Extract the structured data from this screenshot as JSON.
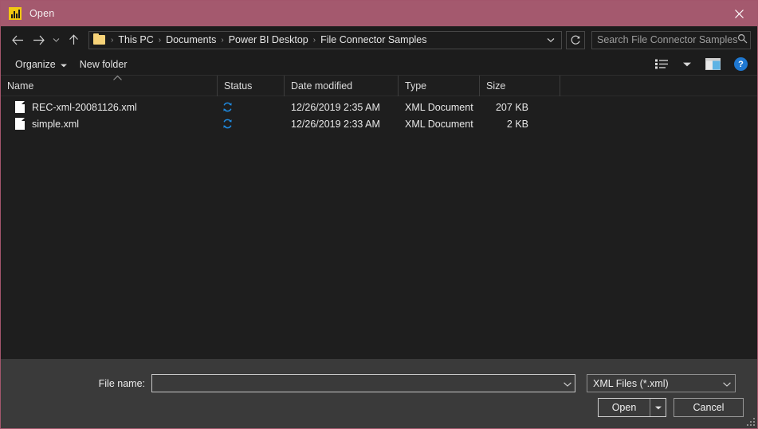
{
  "window": {
    "title": "Open",
    "app_icon": "powerbi-icon",
    "close_label": "✕",
    "titlebar_color": "#a4596e"
  },
  "nav": {
    "back_icon": "←",
    "forward_icon": "→",
    "recent_icon": "⌄",
    "up_icon": "↑",
    "breadcrumb": [
      {
        "label": "This PC"
      },
      {
        "label": "Documents"
      },
      {
        "label": "Power BI Desktop"
      },
      {
        "label": "File Connector Samples"
      }
    ],
    "separator": "›",
    "address_chevron": "⌄",
    "refresh_icon": "↻"
  },
  "search": {
    "placeholder": "Search File Connector Samples",
    "icon": "search-icon"
  },
  "toolbar": {
    "organize_label": "Organize",
    "organize_chevron": "▾",
    "new_folder_label": "New folder",
    "view_icon": "list-view-icon",
    "view_chevron": "▾",
    "preview_pane_icon": "preview-pane-icon",
    "help_label": "?"
  },
  "columns": [
    {
      "key": "name",
      "label": "Name",
      "sort": "ascending"
    },
    {
      "key": "status",
      "label": "Status"
    },
    {
      "key": "date",
      "label": "Date modified"
    },
    {
      "key": "type",
      "label": "Type"
    },
    {
      "key": "size",
      "label": "Size"
    }
  ],
  "sort_caret": "▴",
  "files": [
    {
      "name": "REC-xml-20081126.xml",
      "icon": "xml-document-icon",
      "status_icon": "sync-icon",
      "date": "12/26/2019 2:35 AM",
      "type": "XML Document",
      "size": "207 KB"
    },
    {
      "name": "simple.xml",
      "icon": "xml-document-icon",
      "status_icon": "sync-icon",
      "date": "12/26/2019 2:33 AM",
      "type": "XML Document",
      "size": "2 KB"
    }
  ],
  "footer": {
    "filename_label": "File name:",
    "filename_value": "",
    "filename_chevron": "⌄",
    "filetype_value": "XML Files (*.xml)",
    "filetype_chevron": "⌄",
    "open_label": "Open",
    "open_chevron": "▾",
    "cancel_label": "Cancel"
  },
  "colors": {
    "accent": "#a4596e",
    "status_sync": "#1f8ae0",
    "help_blue": "#1f78d1",
    "powerbi_yellow": "#f2c811"
  }
}
